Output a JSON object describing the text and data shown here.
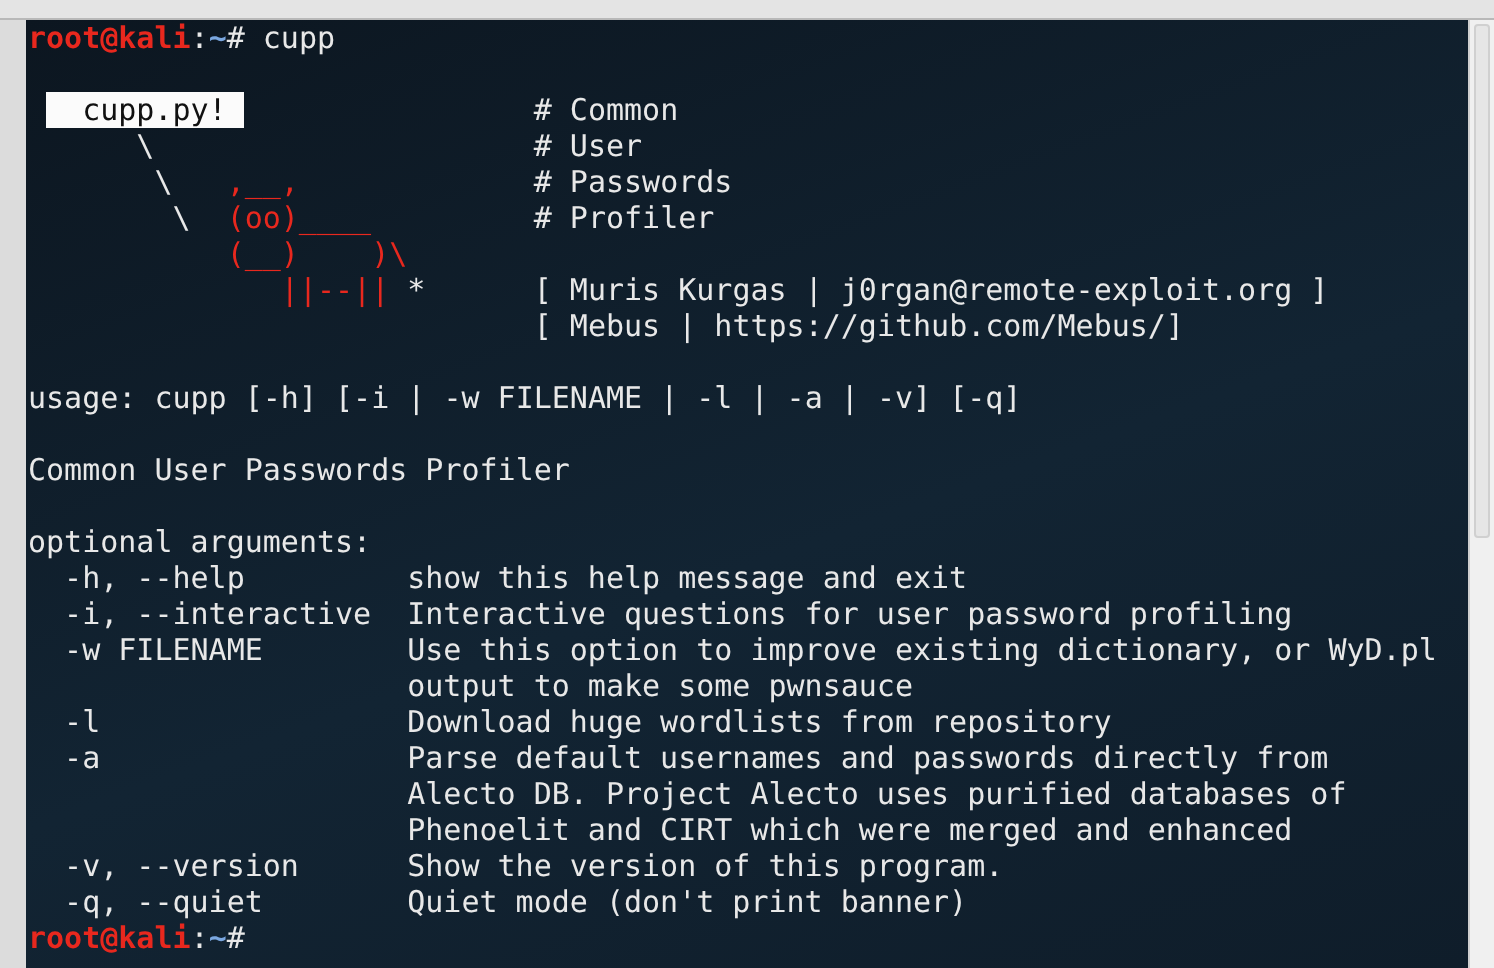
{
  "prompt": {
    "user_host": "root@kali",
    "separator": ":",
    "path": "~",
    "symbol": "#",
    "command": "cupp"
  },
  "banner": [
    {
      "art": [
        {
          "kind": "highlight",
          "text": "  cupp.py! "
        }
      ],
      "info": "# Common"
    },
    {
      "art": [
        {
          "kind": "plain",
          "text": "      \\"
        }
      ],
      "info": "# User"
    },
    {
      "art": [
        {
          "kind": "plain",
          "text": "       \\"
        },
        {
          "kind": "red",
          "text": "   ,__,"
        }
      ],
      "info": "# Passwords"
    },
    {
      "art": [
        {
          "kind": "plain",
          "text": "        \\"
        },
        {
          "kind": "red",
          "text": "  (oo)____"
        }
      ],
      "info": "# Profiler"
    },
    {
      "art": [
        {
          "kind": "red",
          "text": "           (__)    )\\"
        }
      ]
    },
    {
      "art": [
        {
          "kind": "red",
          "text": "              ||--||"
        },
        {
          "kind": "plain",
          "text": " *"
        }
      ],
      "info": "[ Muris Kurgas | j0rgan@remote-exploit.org ]"
    },
    {
      "info": "[ Mebus | https://github.com/Mebus/]"
    }
  ],
  "usage": "usage: cupp [-h] [-i | -w FILENAME | -l | -a | -v] [-q]",
  "description": "Common User Passwords Profiler",
  "arguments_header": "optional arguments:",
  "options": [
    {
      "flag": "-h, --help",
      "description": [
        "show this help message and exit"
      ]
    },
    {
      "flag": "-i, --interactive",
      "description": [
        "Interactive questions for user password profiling"
      ]
    },
    {
      "flag": "-w FILENAME",
      "description": [
        "Use this option to improve existing dictionary, or WyD.pl",
        "output to make some pwnsauce"
      ]
    },
    {
      "flag": "-l",
      "description": [
        "Download huge wordlists from repository"
      ]
    },
    {
      "flag": "-a",
      "description": [
        "Parse default usernames and passwords directly from",
        "Alecto DB. Project Alecto uses purified databases of",
        "Phenoelit and CIRT which were merged and enhanced"
      ]
    },
    {
      "flag": "-v, --version",
      "description": [
        "Show the version of this program."
      ]
    },
    {
      "flag": "-q, --quiet",
      "description": [
        "Quiet mode (don't print banner)"
      ]
    }
  ],
  "final_prompt": {
    "user_host": "root@kali",
    "separator": ":",
    "path": "~",
    "symbol": "#"
  }
}
